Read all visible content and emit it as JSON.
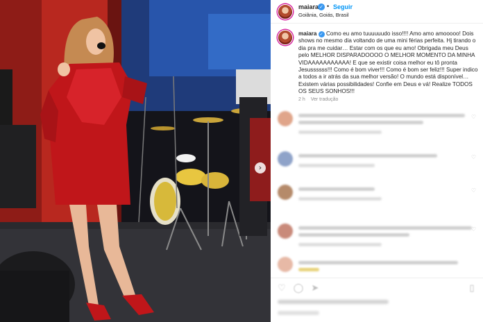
{
  "post": {
    "username": "maiara",
    "verified_glyph": "✓",
    "separator": "•",
    "follow_label": "Seguir",
    "location": "Goiânia, Goiás, Brasil",
    "caption_text": "Como eu amo tuuuuuudo isso!!!! Amo amo amooooo! Dois shows no mesmo dia voltando de uma mini férias perfeita. Hj tirando o dia pra me cuidar… Estar com os que eu amo! Obrigada meu Deus pelo MELHOR DISPARADOOOO O MELHOR MOMENTO DA MINHA VIDAAAAAAAAAAA! E que se existir coisa melhor eu tô pronta Jesussssss!!! Como é bom viver!!! Como é bom ser feliz!!! Super indico a todos a ir atrás da sua melhor versão! O mundo está disponível… Existem várias possibilidades! Confie em Deus e vá! Realize TODOS OS SEUS SONHOS!!!",
    "time_ago": "2 h",
    "see_translation": "Ver tradução"
  },
  "photo": {
    "carousel_next_glyph": "›"
  },
  "actions": {
    "like_icon": "heart-icon",
    "comment_icon": "comment-icon",
    "share_icon": "share-icon",
    "save_icon": "bookmark-icon"
  },
  "colors": {
    "accent": "#0095f6",
    "verified": "#3897f0",
    "dress": "#c0161a",
    "stage_wall": "#b8281f"
  }
}
